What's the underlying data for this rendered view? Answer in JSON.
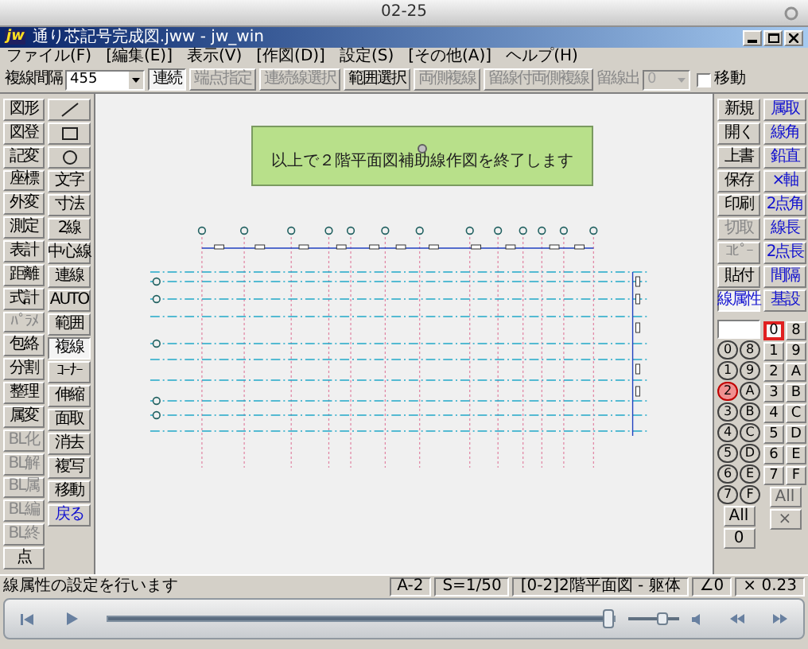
{
  "player": {
    "title": "02-25",
    "progress": {
      "level": 0.99
    },
    "volume": {
      "level": 0.7
    }
  },
  "window": {
    "app_icon": "jw",
    "title": "通り芯記号完成図.jww - jw_win"
  },
  "menu": [
    "ファイル(F)",
    "[編集(E)]",
    "表示(V)",
    "[作図(D)]",
    "設定(S)",
    "[その他(A)]",
    "ヘルプ(H)"
  ],
  "toolbar": [
    {
      "kind": "label",
      "text": "複線間隔",
      "disabled": false
    },
    {
      "kind": "combo",
      "value": "455",
      "disabled": false
    },
    {
      "kind": "button",
      "label": "連続",
      "selected": true,
      "disabled": false
    },
    {
      "kind": "button",
      "label": "端点指定",
      "selected": false,
      "disabled": true
    },
    {
      "kind": "button",
      "label": "連続線選択",
      "selected": false,
      "disabled": true
    },
    {
      "kind": "button",
      "label": "範囲選択",
      "selected": false,
      "disabled": false
    },
    {
      "kind": "button",
      "label": "両側複線",
      "selected": false,
      "disabled": true
    },
    {
      "kind": "button",
      "label": "留線付両側複線",
      "selected": false,
      "disabled": true
    },
    {
      "kind": "label",
      "text": "留線出",
      "disabled": true
    },
    {
      "kind": "combo",
      "value": "0",
      "disabled": true
    },
    {
      "kind": "checkbox",
      "label": "移動",
      "checked": false
    }
  ],
  "left_toolbar": {
    "column_1": [
      {
        "label": "図形",
        "disabled": false,
        "selected": false
      },
      {
        "label": "図登",
        "disabled": false,
        "selected": false
      },
      {
        "label": "記変",
        "disabled": false,
        "selected": false
      },
      {
        "label": "座標",
        "disabled": false,
        "selected": false
      },
      {
        "label": "外変",
        "disabled": false,
        "selected": false
      },
      {
        "label": "測定",
        "disabled": false,
        "selected": false
      },
      {
        "label": "表計",
        "disabled": false,
        "selected": false
      },
      {
        "label": "距離",
        "disabled": false,
        "selected": false
      },
      {
        "label": "式計",
        "disabled": false,
        "selected": false
      },
      {
        "label": "ﾊﾟﾗﾒ",
        "disabled": true,
        "selected": false
      },
      {
        "label": "包絡",
        "disabled": false,
        "selected": false
      },
      {
        "label": "分割",
        "disabled": false,
        "selected": false
      },
      {
        "label": "整理",
        "disabled": false,
        "selected": false
      },
      {
        "label": "属変",
        "disabled": false,
        "selected": false
      },
      {
        "label": "BL化",
        "disabled": true,
        "selected": false
      },
      {
        "label": "BL解",
        "disabled": true,
        "selected": false
      },
      {
        "label": "BL属",
        "disabled": true,
        "selected": false
      },
      {
        "label": "BL編",
        "disabled": true,
        "selected": false
      },
      {
        "label": "BL終",
        "disabled": true,
        "selected": false
      },
      {
        "label": "点",
        "disabled": false,
        "selected": false
      }
    ],
    "column_2": [
      {
        "kind": "line",
        "disabled": false,
        "selected": false
      },
      {
        "kind": "rectangle",
        "disabled": false,
        "selected": false
      },
      {
        "kind": "circle",
        "disabled": false,
        "selected": false
      },
      {
        "kind": "text",
        "label": "文字",
        "disabled": false,
        "selected": false
      },
      {
        "kind": "text",
        "label": "寸法",
        "disabled": false,
        "selected": false
      },
      {
        "kind": "text",
        "label": "2線",
        "disabled": false,
        "selected": false
      },
      {
        "kind": "text",
        "label": "中心線",
        "disabled": false,
        "selected": false
      },
      {
        "kind": "text",
        "label": "連線",
        "disabled": false,
        "selected": false
      },
      {
        "kind": "text",
        "label": "AUTO",
        "disabled": false,
        "selected": false
      },
      {
        "kind": "text",
        "label": "範囲",
        "disabled": false,
        "selected": false
      },
      {
        "kind": "text",
        "label": "複線",
        "disabled": false,
        "selected": true
      },
      {
        "kind": "text",
        "label": "ｺｰﾅｰ",
        "disabled": false,
        "selected": false
      },
      {
        "kind": "text",
        "label": "伸縮",
        "disabled": false,
        "selected": false
      },
      {
        "kind": "text",
        "label": "面取",
        "disabled": false,
        "selected": false
      },
      {
        "kind": "text",
        "label": "消去",
        "disabled": false,
        "selected": false
      },
      {
        "kind": "text",
        "label": "複写",
        "disabled": false,
        "selected": false
      },
      {
        "kind": "text",
        "label": "移動",
        "disabled": false,
        "selected": false
      },
      {
        "kind": "text",
        "label": "戻る",
        "disabled": false,
        "selected": false,
        "color": "#1010d0"
      }
    ]
  },
  "notice": "以上で２階平面図補助線作図を終了します",
  "right_toolbar": {
    "column_1": [
      {
        "label": "新規",
        "disabled": false,
        "selected": false
      },
      {
        "label": "開く",
        "disabled": false,
        "selected": false
      },
      {
        "label": "上書",
        "disabled": false,
        "selected": false
      },
      {
        "label": "保存",
        "disabled": false,
        "selected": false
      },
      {
        "label": "印刷",
        "disabled": false,
        "selected": false
      },
      {
        "label": "切取",
        "disabled": true,
        "selected": false
      },
      {
        "label": "ｺﾋﾟｰ",
        "disabled": true,
        "selected": false
      },
      {
        "label": "貼付",
        "disabled": false,
        "selected": false
      },
      {
        "label": "線属性",
        "disabled": false,
        "selected": true,
        "color": "#1010d0"
      }
    ],
    "column_2": [
      {
        "label": "属取",
        "color": "#1010d0"
      },
      {
        "label": "線角",
        "color": "#1010d0"
      },
      {
        "label": "鉛直",
        "color": "#1010d0"
      },
      {
        "label": "×軸",
        "color": "#1010d0"
      },
      {
        "label": "2点角",
        "color": "#1010d0"
      },
      {
        "label": "線長",
        "color": "#1010d0"
      },
      {
        "label": "2点長",
        "color": "#1010d0"
      },
      {
        "label": "間隔",
        "color": "#1010d0"
      },
      {
        "label": "基設",
        "color": "#1010d0"
      }
    ],
    "layer_groups": [
      {
        "label": "0",
        "selected": false
      },
      {
        "label": "8",
        "selected": false
      },
      {
        "label": "1",
        "selected": false
      },
      {
        "label": "9",
        "selected": false
      },
      {
        "label": "2",
        "selected": true
      },
      {
        "label": "A",
        "selected": false
      },
      {
        "label": "3",
        "selected": false
      },
      {
        "label": "B",
        "selected": false
      },
      {
        "label": "4",
        "selected": false
      },
      {
        "label": "C",
        "selected": false
      },
      {
        "label": "5",
        "selected": false
      },
      {
        "label": "D",
        "selected": false
      },
      {
        "label": "6",
        "selected": false
      },
      {
        "label": "E",
        "selected": false
      },
      {
        "label": "7",
        "selected": false
      },
      {
        "label": "F",
        "selected": false
      }
    ],
    "layer_group_buttons": [
      "All",
      "0"
    ],
    "layers": [
      {
        "label": "0",
        "selected": true
      },
      {
        "label": "8",
        "selected": false
      },
      {
        "label": "1",
        "selected": false
      },
      {
        "label": "9",
        "selected": false
      },
      {
        "label": "2",
        "selected": false
      },
      {
        "label": "A",
        "selected": false
      },
      {
        "label": "3",
        "selected": false
      },
      {
        "label": "B",
        "selected": false
      },
      {
        "label": "4",
        "selected": false
      },
      {
        "label": "C",
        "selected": false
      },
      {
        "label": "5",
        "selected": false
      },
      {
        "label": "D",
        "selected": false
      },
      {
        "label": "6",
        "selected": false
      },
      {
        "label": "E",
        "selected": false
      },
      {
        "label": "7",
        "selected": false
      },
      {
        "label": "F",
        "selected": false
      }
    ],
    "layer_buttons": [
      "All",
      "×"
    ]
  },
  "status_bar": {
    "message": "線属性の設定を行います",
    "fields": [
      "A-2",
      "S=1/50",
      "[0-2]2階平面図 - 躯体",
      "∠0",
      "× 0.23"
    ]
  }
}
